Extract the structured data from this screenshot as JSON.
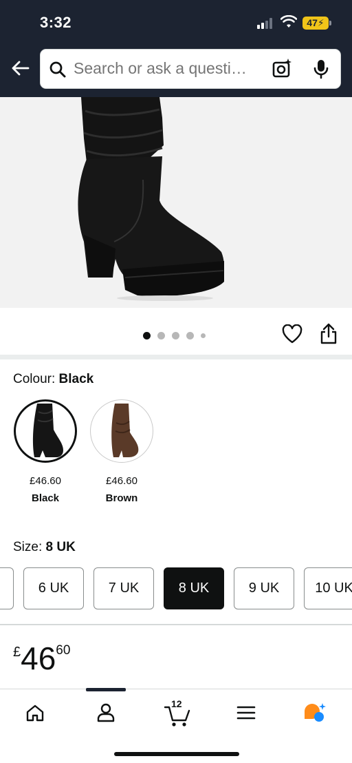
{
  "status_bar": {
    "time": "3:32",
    "battery": "47"
  },
  "header": {
    "back_icon": "back-arrow-icon",
    "search_placeholder": "Search or ask a questi…",
    "camera_icon": "camera-search-icon",
    "mic_icon": "microphone-icon"
  },
  "product_image": {
    "description_icon": "boot-image",
    "carousel_dots": 5,
    "active_dot": 1
  },
  "actions": {
    "wishlist_icon": "heart-icon",
    "share_icon": "share-icon"
  },
  "colour": {
    "label": "Colour:",
    "selected": "Black",
    "options": [
      {
        "price": "£46.60",
        "name": "Black",
        "selected": true
      },
      {
        "price": "£46.60",
        "name": "Brown",
        "selected": false
      }
    ]
  },
  "size": {
    "label": "Size:",
    "selected": "8 UK",
    "options": [
      "6 UK",
      "7 UK",
      "8 UK",
      "9 UK",
      "10 UK"
    ]
  },
  "price": {
    "currency": "£",
    "whole": "46",
    "fraction": "60"
  },
  "bottom_nav": {
    "items": [
      "home-icon",
      "account-icon",
      "cart-icon",
      "menu-icon",
      "rufus-icon"
    ],
    "cart_count": "12",
    "colors": {
      "orange": "#ff8c1a",
      "blue": "#1a8cff"
    }
  }
}
